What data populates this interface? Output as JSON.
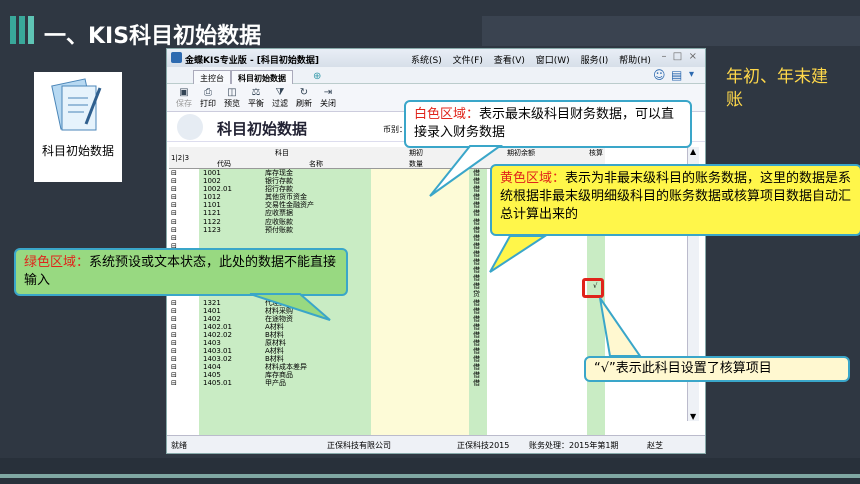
{
  "slide": {
    "title": "一、KIS科目初始数据",
    "side_note": "年初、年末建账",
    "icon_label": "科目初始数据",
    "accent_color": "#39a89a"
  },
  "window": {
    "title": "金蝶KIS专业版 - [科目初始数据]",
    "menu": [
      "系统(S)",
      "文件(F)",
      "查看(V)",
      "窗口(W)",
      "服务(I)",
      "帮助(H)"
    ],
    "tabs": [
      "主控台",
      "科目初始数据"
    ],
    "toolbar": [
      "保存",
      "打印",
      "预览",
      "平衡",
      "过滤",
      "刷新",
      "关闭"
    ],
    "header_title": "科目初始数据",
    "currency_label": "币别："
  },
  "grid": {
    "levels": "1|2|3",
    "col_account": "科目",
    "col_code": "代码",
    "col_name": "名称",
    "col_period": "期初",
    "col_qty": "数量",
    "col_balance": "期初余额",
    "col_check": "核算",
    "rows": [
      {
        "code": "1001",
        "name": "库存现金",
        "dir": "借"
      },
      {
        "code": "1002",
        "name": "银行存款",
        "dir": "借"
      },
      {
        "code": "1002.01",
        "name": "招行存款",
        "dir": "借"
      },
      {
        "code": "1012",
        "name": "其他货币资金",
        "dir": "借"
      },
      {
        "code": "1101",
        "name": "交易性金融资产",
        "dir": "借"
      },
      {
        "code": "1121",
        "name": "应收票据",
        "dir": "借"
      },
      {
        "code": "1122",
        "name": "应收账款",
        "dir": "借"
      },
      {
        "code": "1123",
        "name": "预付账款",
        "dir": "借"
      },
      {
        "code": "",
        "name": "",
        "dir": "借"
      },
      {
        "code": "",
        "name": "",
        "dir": "借"
      },
      {
        "code": "",
        "name": "",
        "dir": "借"
      },
      {
        "code": "",
        "name": "",
        "dir": "借"
      },
      {
        "code": "",
        "name": "",
        "dir": "借"
      },
      {
        "code": "",
        "name": "",
        "dir": "借"
      },
      {
        "code": "1221.02",
        "name": "",
        "dir": "借"
      },
      {
        "code": "1231",
        "name": "坏账准备",
        "dir": "贷"
      },
      {
        "code": "1321",
        "name": "代理业务资产",
        "dir": "借"
      },
      {
        "code": "1401",
        "name": "材料采购",
        "dir": "借"
      },
      {
        "code": "1402",
        "name": "在途物资",
        "dir": "借"
      },
      {
        "code": "1402.01",
        "name": "A材料",
        "dir": "借"
      },
      {
        "code": "1402.02",
        "name": "B材料",
        "dir": "借"
      },
      {
        "code": "1403",
        "name": "原材料",
        "dir": "借"
      },
      {
        "code": "1403.01",
        "name": "A材料",
        "dir": "借"
      },
      {
        "code": "1403.02",
        "name": "B材料",
        "dir": "借"
      },
      {
        "code": "1404",
        "name": "材料成本差异",
        "dir": "借"
      },
      {
        "code": "1405",
        "name": "库存商品",
        "dir": "借"
      },
      {
        "code": "1405.01",
        "name": "甲产品",
        "dir": "借"
      }
    ],
    "check_mark": "√"
  },
  "status": {
    "ready": "就绪",
    "company": "正保科技有限公司",
    "product": "正保科技2015",
    "period": "账务处理：2015年第1期",
    "user": "赵芝"
  },
  "callouts": {
    "white_title": "白色区域：",
    "white_text": "表示最末级科目财务数据，可以直接录入财务数据",
    "yellow_title": "黄色区域：",
    "yellow_text": "表示为非最末级科目的账务数据，这里的数据是系统根据非最末级明细级科目的账务数据或核算项目数据自动汇总计算出来的",
    "green_title": "绿色区域：",
    "green_text": "系统预设或文本状态，此处的数据不能直接输入",
    "check_text": "“√”表示此科目设置了核算项目"
  }
}
